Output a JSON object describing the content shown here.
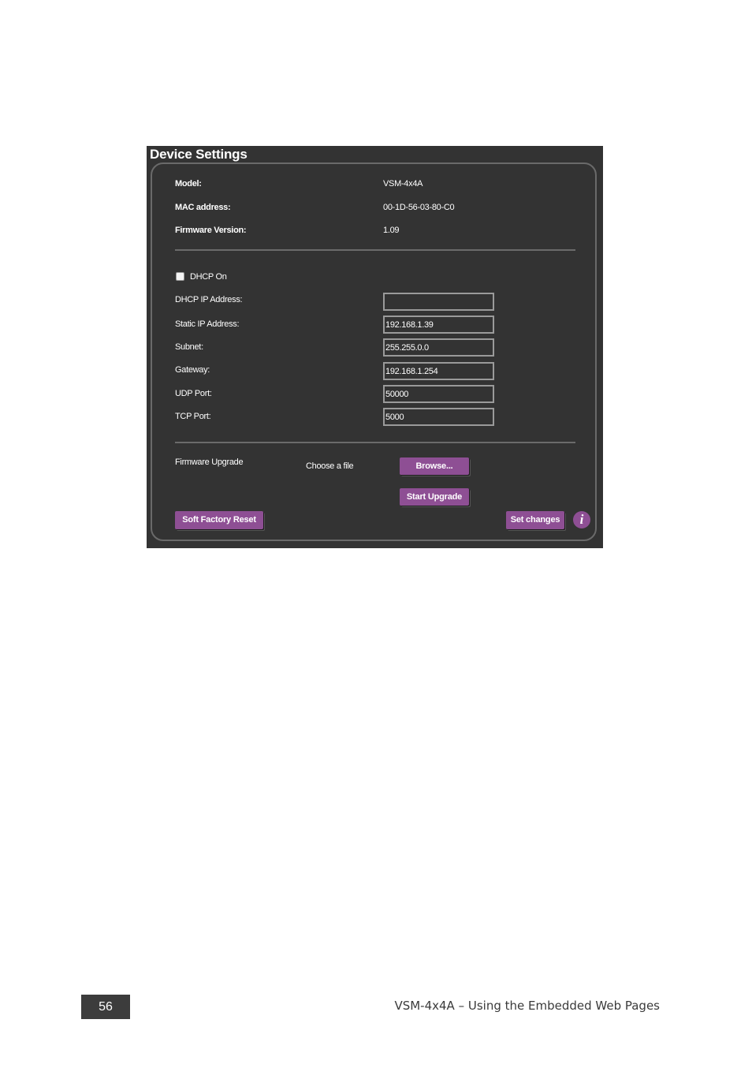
{
  "panel": {
    "title": "Device Settings",
    "info": {
      "model_label": "Model:",
      "model_value": "VSM-4x4A",
      "mac_label": "MAC address:",
      "mac_value": "00-1D-56-03-80-C0",
      "firmware_label": "Firmware Version:",
      "firmware_value": "1.09"
    },
    "network": {
      "dhcp_label": "DHCP On",
      "dhcp_checked": false,
      "dhcp_ip_label": "DHCP IP Address:",
      "dhcp_ip_value": "",
      "static_ip_label": "Static IP Address:",
      "static_ip_value": "192.168.1.39",
      "subnet_label": "Subnet:",
      "subnet_value": "255.255.0.0",
      "gateway_label": "Gateway:",
      "gateway_value": "192.168.1.254",
      "udp_label": "UDP Port:",
      "udp_value": "50000",
      "tcp_label": "TCP Port:",
      "tcp_value": "5000"
    },
    "upgrade": {
      "label": "Firmware Upgrade",
      "choose_file": "Choose a file",
      "browse_button": "Browse...",
      "start_button": "Start Upgrade"
    },
    "actions": {
      "soft_reset_button": "Soft Factory Reset",
      "set_changes_button": "Set changes",
      "info_icon_glyph": "i"
    },
    "colors": {
      "panel_bg": "#333333",
      "accent": "#8e4f94"
    }
  },
  "footer": {
    "page_number": "56",
    "title": "VSM-4x4A – Using the Embedded Web Pages"
  }
}
